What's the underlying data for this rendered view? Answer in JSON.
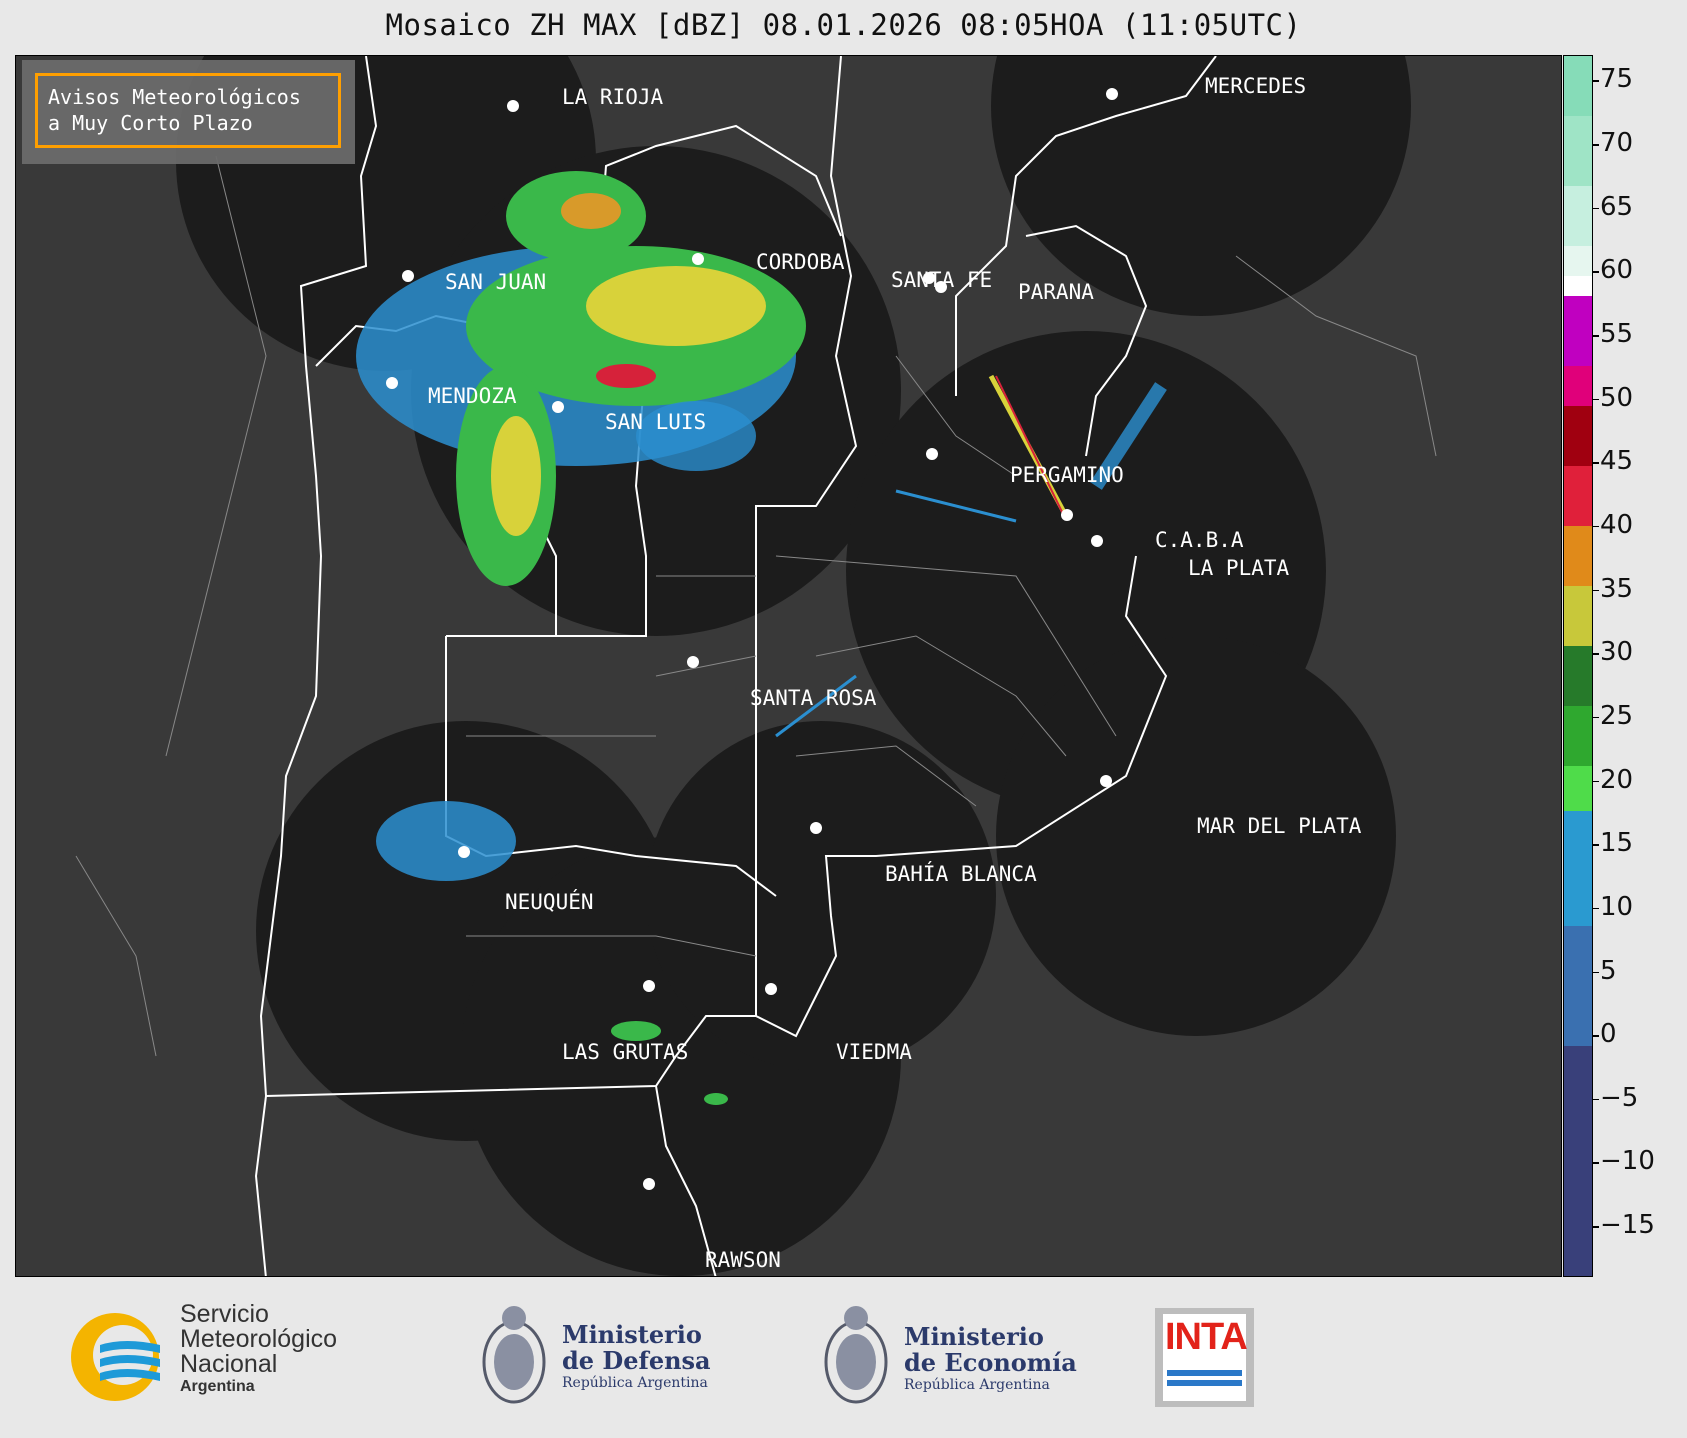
{
  "title": "Mosaico ZH MAX [dBZ] 08.01.2026 08:05HOA (11:05UTC)",
  "badge": {
    "line1": "Avisos Meteorológicos",
    "line2": "a Muy Corto Plazo"
  },
  "colors": {
    "accent": "#ff9f00",
    "map_bg": "#393939",
    "radar_bg": "#1c1c1c"
  },
  "cities": [
    {
      "name": "LA RIOJA"
    },
    {
      "name": "CORDOBA"
    },
    {
      "name": "SAN JUAN"
    },
    {
      "name": "SANTA FE"
    },
    {
      "name": "PARANA"
    },
    {
      "name": "MENDOZA"
    },
    {
      "name": "SAN LUIS"
    },
    {
      "name": "PERGAMINO"
    },
    {
      "name": "C.A.B.A"
    },
    {
      "name": "LA PLATA"
    },
    {
      "name": "SANTA ROSA"
    },
    {
      "name": "MAR DEL PLATA"
    },
    {
      "name": "BAHÍA BLANCA"
    },
    {
      "name": "NEUQUÉN"
    },
    {
      "name": "LAS GRUTAS"
    },
    {
      "name": "VIEDMA"
    },
    {
      "name": "RAWSON"
    },
    {
      "name": "MERCEDES"
    }
  ],
  "colorbar": {
    "ticks": [
      "75",
      "70",
      "65",
      "60",
      "55",
      "50",
      "45",
      "40",
      "35",
      "30",
      "25",
      "20",
      "15",
      "10",
      "5",
      "0",
      "−5",
      "−10",
      "−15"
    ],
    "min": -19,
    "max": 77
  },
  "footer": {
    "smn": {
      "line1": "Servicio",
      "line2": "Meteorológico",
      "line3": "Nacional",
      "line4": "Argentina"
    },
    "defensa": {
      "line1": "Ministerio",
      "line2": "de Defensa",
      "line3": "República Argentina"
    },
    "economia": {
      "line1": "Ministerio",
      "line2": "de Economía",
      "line3": "República Argentina"
    },
    "inta": {
      "label": "INTA"
    }
  }
}
